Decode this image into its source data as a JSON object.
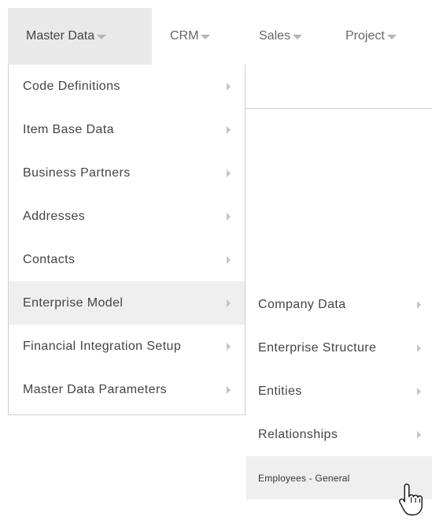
{
  "menubar": {
    "items": [
      {
        "label": "Master Data",
        "active": true
      },
      {
        "label": "CRM",
        "active": false
      },
      {
        "label": "Sales",
        "active": false
      },
      {
        "label": "Project",
        "active": false
      }
    ]
  },
  "master_data_menu": {
    "items": [
      {
        "label": "Code Definitions"
      },
      {
        "label": "Item Base Data"
      },
      {
        "label": "Business Partners"
      },
      {
        "label": "Addresses"
      },
      {
        "label": "Contacts"
      },
      {
        "label": "Enterprise Model",
        "active": true
      },
      {
        "label": "Financial Integration Setup"
      },
      {
        "label": "Master Data Parameters"
      }
    ]
  },
  "enterprise_model_submenu": {
    "items": [
      {
        "label": "Company Data"
      },
      {
        "label": "Enterprise Structure"
      },
      {
        "label": "Entities"
      },
      {
        "label": "Relationships"
      },
      {
        "label": "Employees - General",
        "hovered": true
      }
    ]
  },
  "icons": {
    "menubar_caret": "caret-down-icon",
    "submenu_arrow": "chevron-right-icon",
    "cursor": "hand-pointer-icon"
  },
  "colors": {
    "active_menubar_bg": "#e9e9e9",
    "active_item_bg": "#efefef",
    "text": "#444444",
    "muted_text": "#666666",
    "border": "#cfcfcf"
  }
}
